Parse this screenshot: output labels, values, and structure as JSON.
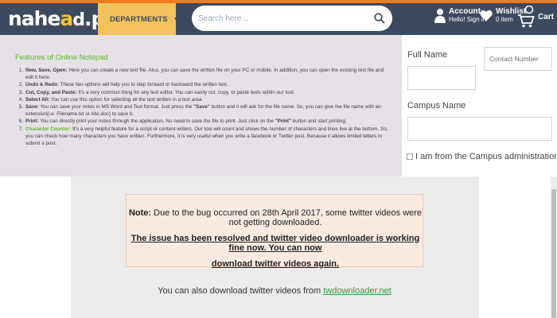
{
  "header": {
    "logo_left": "nahe",
    "logo_mid": "a",
    "logo_dot": "d",
    "logo_right": ".pk",
    "departments_label": "DEPARTMENTS",
    "search_placeholder": "Search here...",
    "account_title": "Account",
    "account_sub": "Hello! Sign in",
    "wishlist_title": "Wishlist",
    "wishlist_sub": "0 item",
    "cart_label": "Cart",
    "colors": {
      "bar": "#3c4a5f",
      "accent": "#f07b1d",
      "departments": "#f4c25a"
    }
  },
  "notepad": {
    "title": "Features of Online Notepad",
    "items": [
      {
        "num": "1.",
        "head": "New, Save, Open:",
        "text": " Here you can create a new text file. Also, you can save the written file on your PC or mobile. In addition, you can open the existing text file and edit it here."
      },
      {
        "num": "2.",
        "head": "Undo & Redo:",
        "text": " These two options will help you to step forward or backward the written text."
      },
      {
        "num": "3.",
        "head": "Cut, Copy, and Paste:",
        "text": " It's a very common thing for any text editor. You can easily cut, copy, or paste texts within our tool."
      },
      {
        "num": "4.",
        "head": "Select All:",
        "text": " You can use this option for selecting all the text written in a text area."
      },
      {
        "num": "5.",
        "head": "Save:",
        "text_a": " You can save your notes in MS Word and Text format. Just press the ",
        "quote": "\"Save\"",
        "text_b": " button and it will ask for the file name. So, you can give the file name with an extension(i.e. Filename.txt or Abc.doc) to save it."
      },
      {
        "num": "6.",
        "head": "Print:",
        "text_a": " You can directly print your notes through the application. No need to save the file to print. Just click on the ",
        "quote": "\"Print\"",
        "text_b": " button and start printing."
      },
      {
        "num": "7.",
        "head": "Character Counter:",
        "text": " It's a very helpful feature for a script or content writers. Our tool will count and shows the number of characters and lines live at the bottom. So, you can check how many characters you have written. Furthermore, it is very useful when you write a facebook or Twitter post. Because it allows limited letters to submit a post."
      }
    ]
  },
  "form": {
    "full_name_label": "Full Name",
    "contact_placeholder": "Contact Number",
    "campus_label": "Campus Name",
    "checkbox_label": "I am from the Campus administration team"
  },
  "notice": {
    "note_label": "Note:",
    "line1": " Due to the bug occurred on 28th April 2017, some twitter videos were not getting downloaded.",
    "line2": "The issue has been resolved and twitter video downloader is working fine now. You can now",
    "line3": "download twitter videos again.",
    "also_text": "You can also download twitter videos from ",
    "also_link": "twdownloader.net"
  }
}
